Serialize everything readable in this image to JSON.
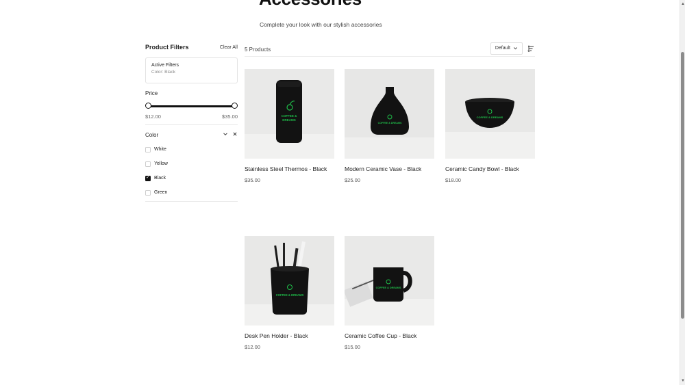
{
  "page": {
    "title": "Accessories",
    "subtitle": "Complete your look with our stylish accessories"
  },
  "filters": {
    "title": "Product Filters",
    "clear_all": "Clear All",
    "active": {
      "title": "Active Filters",
      "value": "Color: Black"
    },
    "price": {
      "title": "Price",
      "min_label": "$12.00",
      "max_label": "$35.00",
      "min_value": 12,
      "max_value": 35
    },
    "color": {
      "title": "Color",
      "options": [
        {
          "label": "White",
          "checked": false
        },
        {
          "label": "Yellow",
          "checked": false
        },
        {
          "label": "Black",
          "checked": true
        },
        {
          "label": "Green",
          "checked": false
        }
      ]
    }
  },
  "toolbar": {
    "count": "5 Products",
    "sort_label": "Default"
  },
  "products": [
    {
      "name": "Stainless Steel Thermos - Black",
      "price": "$35.00",
      "icon": "thermos"
    },
    {
      "name": "Modern Ceramic Vase - Black",
      "price": "$25.00",
      "icon": "vase"
    },
    {
      "name": "Ceramic Candy Bowl - Black",
      "price": "$18.00",
      "icon": "bowl"
    },
    {
      "name": "Desk Pen Holder - Black",
      "price": "$12.00",
      "icon": "pen-holder"
    },
    {
      "name": "Ceramic Coffee Cup - Black",
      "price": "$15.00",
      "icon": "mug"
    }
  ],
  "colors": {
    "accent_logo": "#1fbf4a",
    "product_black": "#111111",
    "background": "#ffffff"
  }
}
